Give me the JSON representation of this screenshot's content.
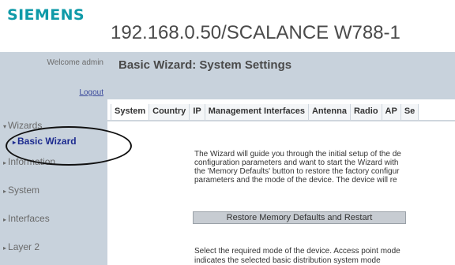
{
  "header": {
    "brand": "SIEMENS",
    "device_title": "192.168.0.50/SCALANCE W788-1"
  },
  "sidebar": {
    "welcome": "Welcome admin",
    "logout": "Logout",
    "items": [
      {
        "label": "Wizards"
      },
      {
        "label": "Basic Wizard"
      },
      {
        "label": "Information"
      },
      {
        "label": "System"
      },
      {
        "label": "Interfaces"
      },
      {
        "label": "Layer 2"
      }
    ]
  },
  "main": {
    "title": "Basic Wizard: System Settings",
    "tabs": [
      "System",
      "Country",
      "IP",
      "Management Interfaces",
      "Antenna",
      "Radio",
      "AP",
      "Se"
    ],
    "active_tab": "System",
    "intro_lines": [
      "The Wizard will guide you through the initial setup of the de",
      "configuration parameters and want to start the Wizard with",
      "the 'Memory Defaults' button to restore the factory configur",
      "parameters and the mode of the device. The device will re"
    ],
    "restore_button": "Restore Memory Defaults and Restart",
    "mode_text": "Select the required mode of the device. Access point mode",
    "mode_text_partial": "indicates the selected basic distribution system mode"
  },
  "icons": {
    "expanded_arrow": "triangle-down",
    "collapsed_arrow": "triangle-right"
  },
  "colors": {
    "brand": "#0f9aa8",
    "panel": "#c8d2dc",
    "active_nav": "#1c2a8f"
  }
}
